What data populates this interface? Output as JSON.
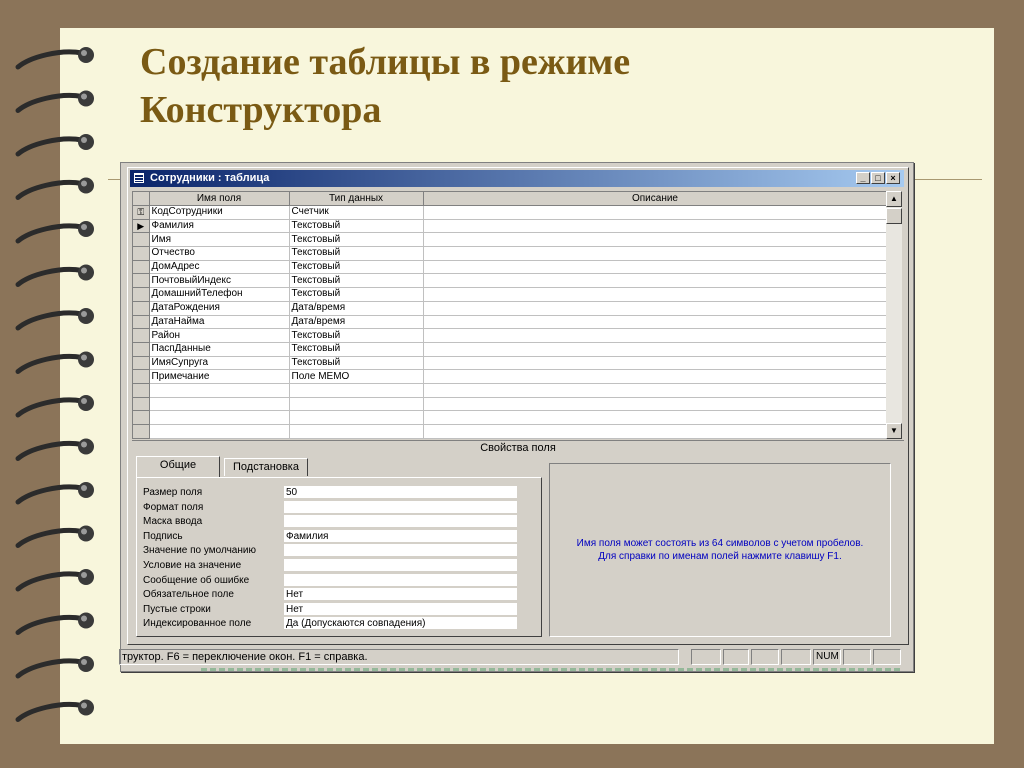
{
  "slide": {
    "title_line1": "Создание таблицы в  режиме",
    "title_line2": "Конструктора"
  },
  "window": {
    "title": "Сотрудники : таблица",
    "controls": [
      "_",
      "□",
      "×"
    ]
  },
  "grid": {
    "columns": [
      "Имя поля",
      "Тип данных",
      "Описание"
    ],
    "rows": [
      {
        "name": "КодСотрудники",
        "type": "Счетчик",
        "description": ""
      },
      {
        "name": "Фамилия",
        "type": "Текстовый",
        "description": ""
      },
      {
        "name": "Имя",
        "type": "Текстовый",
        "description": ""
      },
      {
        "name": "Отчество",
        "type": "Текстовый",
        "description": ""
      },
      {
        "name": "ДомАдрес",
        "type": "Текстовый",
        "description": ""
      },
      {
        "name": "ПочтовыйИндекс",
        "type": "Текстовый",
        "description": ""
      },
      {
        "name": "ДомашнийТелефон",
        "type": "Текстовый",
        "description": ""
      },
      {
        "name": "ДатаРождения",
        "type": "Дата/время",
        "description": ""
      },
      {
        "name": "ДатаНайма",
        "type": "Дата/время",
        "description": ""
      },
      {
        "name": "Район",
        "type": "Текстовый",
        "description": ""
      },
      {
        "name": "ПаспДанные",
        "type": "Текстовый",
        "description": ""
      },
      {
        "name": "ИмяСупруга",
        "type": "Текстовый",
        "description": ""
      },
      {
        "name": "Примечание",
        "type": "Поле МЕМО",
        "description": ""
      },
      {
        "name": "",
        "type": "",
        "description": ""
      },
      {
        "name": "",
        "type": "",
        "description": ""
      },
      {
        "name": "",
        "type": "",
        "description": ""
      },
      {
        "name": "",
        "type": "",
        "description": ""
      }
    ],
    "key_row_index": 0,
    "current_row_index": 1
  },
  "properties": {
    "section_label": "Свойства поля",
    "tabs": [
      "Общие",
      "Подстановка"
    ],
    "active_tab": "Общие",
    "items": [
      {
        "label": "Размер поля",
        "value": "50"
      },
      {
        "label": "Формат поля",
        "value": ""
      },
      {
        "label": "Маска ввода",
        "value": ""
      },
      {
        "label": "Подпись",
        "value": "Фамилия"
      },
      {
        "label": "Значение по умолчанию",
        "value": ""
      },
      {
        "label": "Условие на значение",
        "value": ""
      },
      {
        "label": "Сообщение об ошибке",
        "value": ""
      },
      {
        "label": "Обязательное поле",
        "value": "Нет"
      },
      {
        "label": "Пустые строки",
        "value": "Нет"
      },
      {
        "label": "Индексированное поле",
        "value": "Да (Допускаются совпадения)"
      }
    ],
    "help_line1": "Имя поля может состоять из 64 символов с учетом пробелов.",
    "help_line2": "Для справки по именам полей нажмите клавишу F1."
  },
  "status_bar": {
    "text": "труктор.  F6 = переключение окон.  F1 = справка.",
    "num_indicator": "NUM"
  },
  "colors": {
    "background": "#8b7459",
    "paper": "#f8f6dc",
    "title": "#7a5a14",
    "titlebar_start": "#0a246a",
    "titlebar_end": "#a6caf0",
    "help_text": "#0000c0"
  },
  "icons": {
    "key_row": "key-icon",
    "current_row": "row-pointer-icon",
    "window": "table-icon"
  }
}
